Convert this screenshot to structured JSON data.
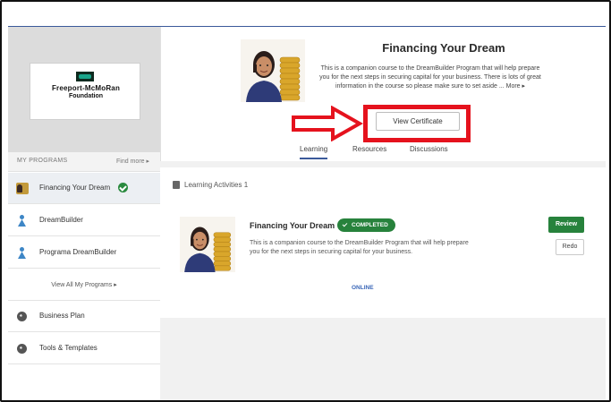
{
  "logo": {
    "line1": "Freeport-McMoRan",
    "line2": "Foundation"
  },
  "sidebar": {
    "section_label": "MY PROGRAMS",
    "find_more": "Find more ▸",
    "items": [
      {
        "label": "Financing Your Dream",
        "icon": "course-thumbnail-icon",
        "completed": true
      },
      {
        "label": "DreamBuilder",
        "icon": "person-icon"
      },
      {
        "label": "Programa DreamBuilder",
        "icon": "person-icon"
      }
    ],
    "view_all": "View All My Programs ▸",
    "extra_items": [
      {
        "label": "Business Plan",
        "icon": "globe-icon"
      },
      {
        "label": "Tools & Templates",
        "icon": "globe-icon"
      }
    ]
  },
  "course": {
    "title": "Financing Your Dream",
    "description": "This is a companion course to the DreamBuilder Program that will help prepare you for the next steps in securing capital for your business. There is lots of great information in the course so please make sure to set aside ... More ▸",
    "view_certificate": "View Certificate",
    "tabs": [
      "Learning",
      "Resources",
      "Discussions"
    ],
    "active_tab": "Learning"
  },
  "activities": {
    "heading": "Learning Activities",
    "count": "1",
    "item": {
      "title": "Financing Your Dream",
      "status": "COMPLETED",
      "description": "This is a companion course to the DreamBuilder Program that will help prepare you for the next steps in securing capital for your business.",
      "mode": "ONLINE",
      "review_label": "Review",
      "redo_label": "Redo"
    }
  },
  "colors": {
    "accent_blue": "#3b5a9a",
    "success_green": "#27823c",
    "highlight_red": "#e5121d"
  }
}
